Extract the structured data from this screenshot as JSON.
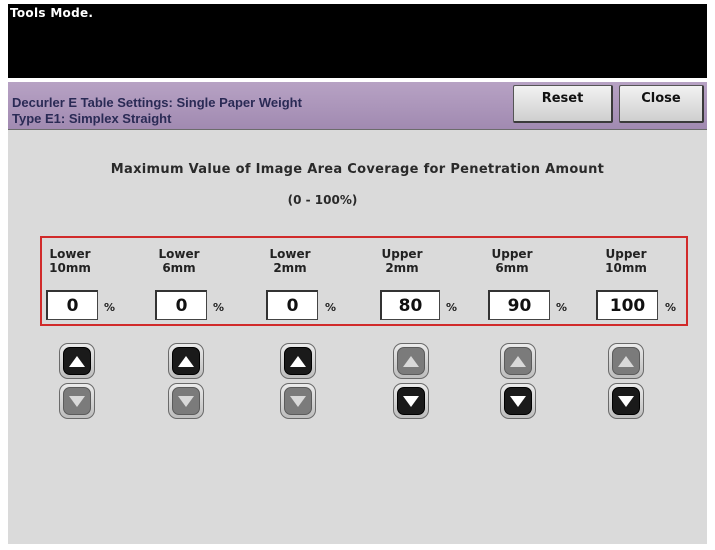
{
  "header": {
    "mode": "Tools Mode."
  },
  "title": {
    "line1": "Decurler E Table Settings:  Single Paper Weight",
    "line2": "Type E1:   Simplex Straight"
  },
  "buttons": {
    "reset": "Reset",
    "close": "Close"
  },
  "heading": "Maximum Value of Image Area Coverage for Penetration Amount",
  "range": "(0  -  100%)",
  "unit": "%",
  "columns": [
    {
      "line1": "Lower",
      "line2": "10mm",
      "value": "0",
      "up_enabled": true,
      "down_enabled": false
    },
    {
      "line1": "Lower",
      "line2": "6mm",
      "value": "0",
      "up_enabled": true,
      "down_enabled": false
    },
    {
      "line1": "Lower",
      "line2": "2mm",
      "value": "0",
      "up_enabled": true,
      "down_enabled": false
    },
    {
      "line1": "Upper",
      "line2": "2mm",
      "value": "80",
      "up_enabled": false,
      "down_enabled": true
    },
    {
      "line1": "Upper",
      "line2": "6mm",
      "value": "90",
      "up_enabled": false,
      "down_enabled": true
    },
    {
      "line1": "Upper",
      "line2": "10mm",
      "value": "100",
      "up_enabled": false,
      "down_enabled": true
    }
  ],
  "colors": {
    "title_bar": "#a18ab1",
    "highlight": "#d12a2a",
    "panel": "#dadada"
  },
  "icons": {
    "up": "up-arrow-icon",
    "down": "down-arrow-icon"
  }
}
